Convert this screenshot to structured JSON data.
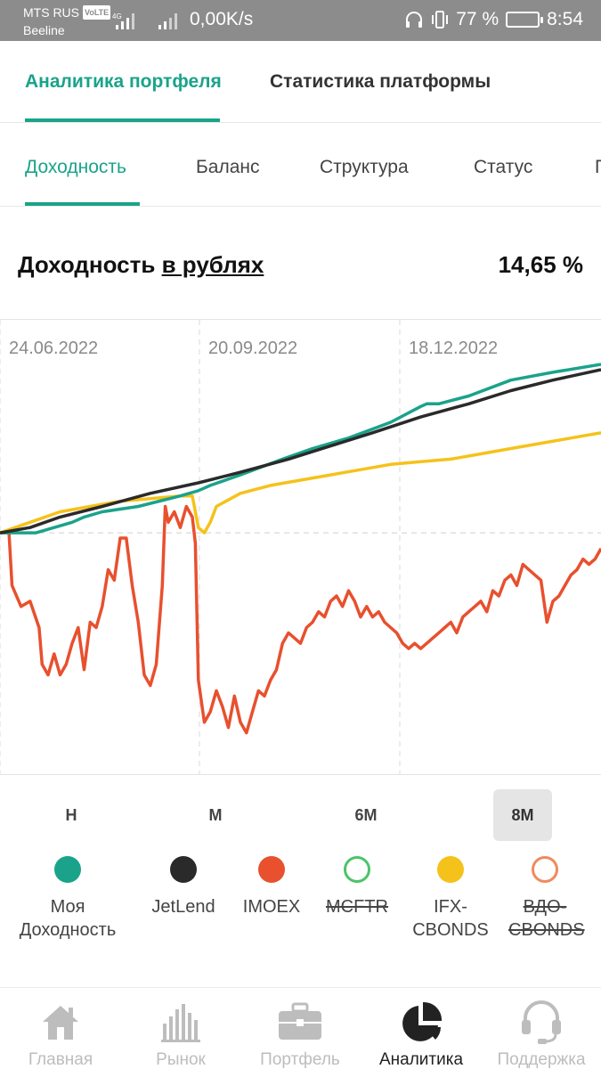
{
  "status_bar": {
    "operator1": "MTS RUS",
    "volte": "VoLTE",
    "network": "4G",
    "operator2": "Beeline",
    "speed": "0,00K/s",
    "battery": "77 %",
    "time": "8:54"
  },
  "top_tabs": [
    {
      "label": "Аналитика портфеля",
      "active": true
    },
    {
      "label": "Статистика платформы",
      "active": false
    }
  ],
  "sub_tabs": [
    {
      "label": "Доходность",
      "active": true
    },
    {
      "label": "Баланс",
      "active": false
    },
    {
      "label": "Структура",
      "active": false
    },
    {
      "label": "Статус",
      "active": false
    },
    {
      "label": "П",
      "active": false
    }
  ],
  "section": {
    "title_prefix": "Доходность",
    "title_link": "в рублях",
    "value": "14,65 %"
  },
  "chart_data": {
    "type": "line",
    "x_tick_labels": [
      "24.06.2022",
      "20.09.2022",
      "18.12.2022"
    ],
    "x_range": [
      0,
      100
    ],
    "y_range": [
      -45,
      32
    ],
    "series": [
      {
        "name": "Моя Доходность",
        "color": "#1aa38a",
        "visible": true,
        "x": [
          0,
          6,
          12,
          14,
          17,
          23,
          30,
          33,
          35,
          40,
          47,
          52,
          58,
          65,
          70,
          71,
          73,
          78,
          85,
          92,
          100
        ],
        "y": [
          0,
          0,
          2,
          3,
          4,
          5,
          7,
          8,
          9,
          11,
          14,
          16,
          18,
          21,
          24,
          24.5,
          24.5,
          26,
          29,
          30.5,
          32
        ]
      },
      {
        "name": "JetLend",
        "color": "#2a2a2a",
        "visible": true,
        "x": [
          0,
          5,
          10,
          17,
          25,
          33,
          40,
          48,
          55,
          62,
          70,
          78,
          85,
          92,
          100
        ],
        "y": [
          0,
          1,
          3,
          5,
          7.5,
          9.5,
          11.5,
          14,
          16.5,
          19,
          22,
          24.5,
          27,
          29,
          31
        ]
      },
      {
        "name": "IMOEX",
        "color": "#e8502e",
        "visible": true,
        "x": [
          0,
          1.5,
          2,
          3.5,
          5,
          6.5,
          7,
          8,
          9,
          10,
          11,
          12,
          13,
          14,
          15,
          16,
          17,
          18,
          19,
          20,
          21,
          22,
          23,
          24,
          25,
          26,
          27,
          27.5,
          28,
          29,
          30,
          31,
          32,
          32.5,
          33,
          34,
          35,
          36,
          37,
          38,
          39,
          40,
          41,
          42,
          43,
          44,
          45,
          46,
          47,
          48,
          49,
          50,
          51,
          52,
          53,
          54,
          55,
          56,
          57,
          58,
          59,
          60,
          61,
          62,
          63,
          64,
          65,
          66,
          67,
          68,
          69,
          70,
          71,
          72,
          73,
          74,
          75,
          76,
          77,
          78,
          79,
          80,
          81,
          82,
          83,
          84,
          85,
          86,
          87,
          88,
          89,
          90,
          91,
          92,
          93,
          94,
          95,
          96,
          97,
          98,
          99,
          100
        ],
        "y": [
          0,
          0,
          -10,
          -14,
          -13,
          -18,
          -25,
          -27,
          -23,
          -27,
          -25,
          -21,
          -18,
          -26,
          -17,
          -18,
          -14,
          -7,
          -9,
          -1,
          -1,
          -10,
          -17,
          -27,
          -29,
          -25,
          -10,
          5,
          2,
          4,
          1,
          5,
          3,
          -2,
          -28,
          -36,
          -34,
          -30,
          -33,
          -37,
          -31,
          -36,
          -38,
          -34,
          -30,
          -31,
          -28,
          -26,
          -21,
          -19,
          -20,
          -21,
          -18,
          -17,
          -15,
          -16,
          -13,
          -12,
          -14,
          -11,
          -13,
          -16,
          -14,
          -16,
          -15,
          -17,
          -18,
          -19,
          -21,
          -22,
          -21,
          -22,
          -21,
          -20,
          -19,
          -18,
          -17,
          -19,
          -16,
          -15,
          -14,
          -13,
          -15,
          -11,
          -12,
          -9,
          -8,
          -10,
          -6,
          -7,
          -8,
          -9,
          -17,
          -13,
          -12,
          -10,
          -8,
          -7,
          -5,
          -6,
          -5,
          -3
        ]
      },
      {
        "name": "MCFTR",
        "color": "#1aa38a",
        "visible": false,
        "x": [],
        "y": []
      },
      {
        "name": "IFX-CBONDS",
        "color": "#f5c21b",
        "visible": true,
        "x": [
          0,
          5,
          10,
          15,
          20,
          25,
          30,
          32,
          33,
          34,
          35,
          36,
          40,
          45,
          50,
          55,
          60,
          65,
          70,
          75,
          80,
          85,
          90,
          95,
          100
        ],
        "y": [
          0,
          2,
          4,
          5,
          6,
          6.5,
          7,
          7,
          1,
          0,
          2,
          5,
          7.5,
          9,
          10,
          11,
          12,
          13,
          13.5,
          14,
          15,
          16,
          17,
          18,
          19
        ]
      },
      {
        "name": "ВДО-CBONDS",
        "color": "#f08a5d",
        "visible": false,
        "x": [],
        "y": []
      }
    ]
  },
  "periods": [
    {
      "label": "Н",
      "active": false
    },
    {
      "label": "М",
      "active": false
    },
    {
      "label": "6М",
      "active": false
    },
    {
      "label": "8М",
      "active": true
    }
  ],
  "legend": [
    {
      "label": "Моя Доходность",
      "color": "#1aa38a",
      "filled": true,
      "struck": false
    },
    {
      "label": "JetLend",
      "color": "#2a2a2a",
      "filled": true,
      "struck": false
    },
    {
      "label": "IMOEX",
      "color": "#e8502e",
      "filled": true,
      "struck": false
    },
    {
      "label": "MCFTR",
      "color": "#4cc36a",
      "filled": false,
      "struck": true
    },
    {
      "label": "IFX-CBONDS",
      "color": "#f5c21b",
      "filled": true,
      "struck": false
    },
    {
      "label": "ВДО-CBONDS",
      "color": "#f08a5d",
      "filled": false,
      "struck": true
    }
  ],
  "bottom_nav": [
    {
      "label": "Главная",
      "icon": "home-icon",
      "active": false
    },
    {
      "label": "Рынок",
      "icon": "market-icon",
      "active": false
    },
    {
      "label": "Портфель",
      "icon": "briefcase-icon",
      "active": false
    },
    {
      "label": "Аналитика",
      "icon": "pie-chart-icon",
      "active": true
    },
    {
      "label": "Поддержка",
      "icon": "headset-icon",
      "active": false
    }
  ]
}
